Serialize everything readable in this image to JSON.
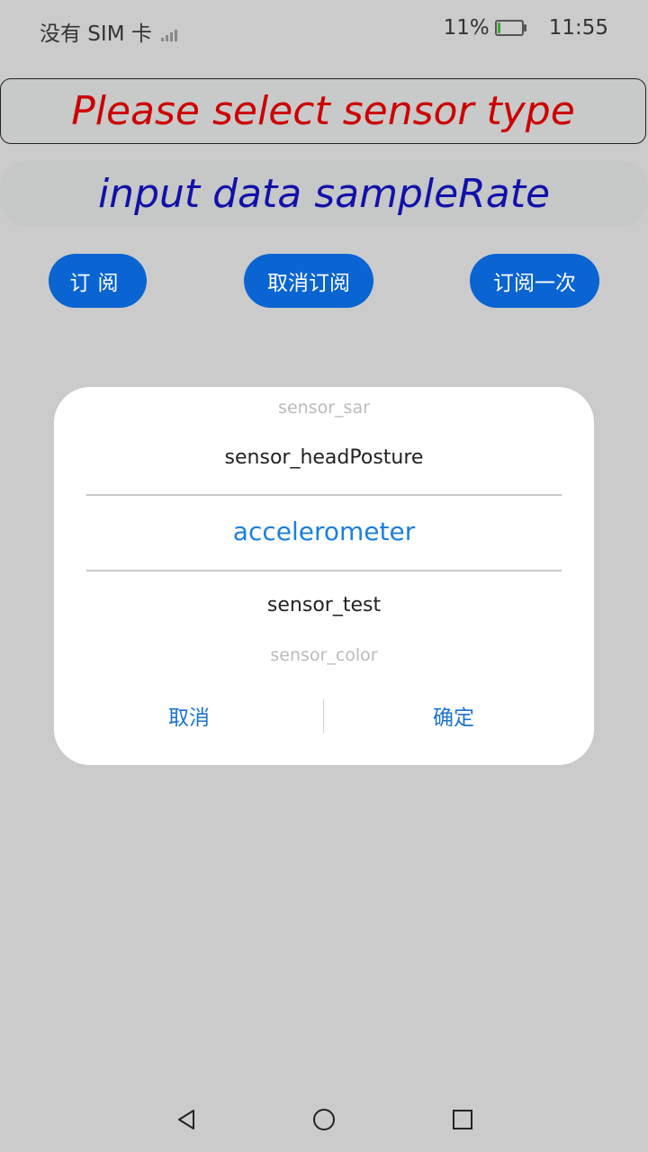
{
  "status_bar": {
    "carrier": "没有 SIM 卡",
    "battery_percent": "11%",
    "battery_level": 0.11,
    "time": "11:55",
    "icons": [
      "signal-icon",
      "battery-icon"
    ]
  },
  "sensor_select": {
    "placeholder": "Please select sensor type",
    "color": "#cc0000"
  },
  "sample_rate": {
    "placeholder": "input data sampleRate",
    "color": "#1111aa"
  },
  "buttons": {
    "subscribe": "订阅",
    "unsubscribe": "取消订阅",
    "subscribe_once": "订阅一次",
    "color": "#0a64d2"
  },
  "picker_dialog": {
    "items": [
      "sensor_sar",
      "sensor_headPosture",
      "accelerometer",
      "sensor_test",
      "sensor_color"
    ],
    "selected": "accelerometer",
    "cancel": "取消",
    "confirm": "确定",
    "accent": "#1a80e0"
  },
  "nav_bar": {
    "icons": [
      "back-icon",
      "home-icon",
      "recent-apps-icon"
    ]
  }
}
